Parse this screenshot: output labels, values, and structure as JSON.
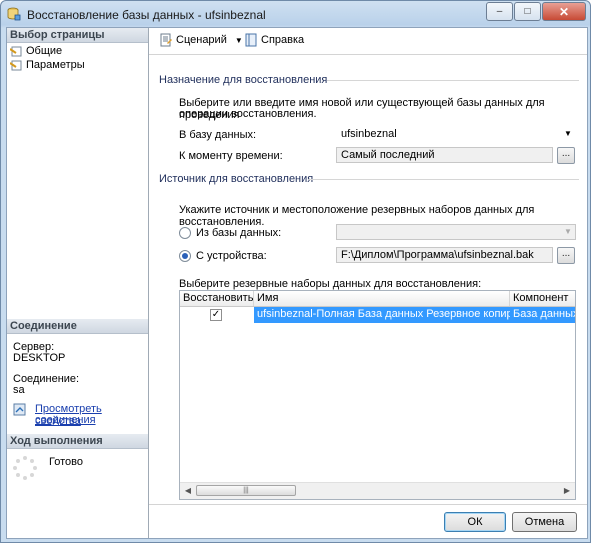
{
  "window": {
    "title": "Восстановление базы данных - ufsinbeznal",
    "minimize_glyph": "–",
    "maximize_glyph": "□",
    "close_glyph": "✕"
  },
  "left": {
    "pages_header": "Выбор страницы",
    "pages": [
      {
        "label": "Общие",
        "icon": "page-icon"
      },
      {
        "label": "Параметры",
        "icon": "page-icon"
      }
    ],
    "connection_header": "Соединение",
    "server_label": "Сервер:",
    "server_value": "DESKTOP",
    "connection_label": "Соединение:",
    "connection_value": "sa",
    "view_props_link_line1": "Просмотреть свойства",
    "view_props_link_line2": "соединения",
    "progress_header": "Ход выполнения",
    "progress_status": "Готово"
  },
  "toolbar": {
    "script_label": "Сценарий",
    "help_label": "Справка"
  },
  "destination": {
    "group_label": "Назначение для восстановления",
    "hint_line1": "Выберите или введите имя новой или существующей базы данных для проведения",
    "hint_line2": "операции восстановления.",
    "to_db_label": "В базу данных:",
    "to_db_value": "ufsinbeznal",
    "point_in_time_label": "К моменту времени:",
    "point_in_time_value": "Самый последний"
  },
  "source": {
    "group_label": "Источник для восстановления",
    "hint": "Укажите источник и местоположение резервных наборов данных для восстановления.",
    "from_db_label": "Из базы данных:",
    "from_db_value": "",
    "from_device_label": "С устройства:",
    "from_device_value": "F:\\Диплом\\Программа\\ufsinbeznal.bak",
    "selected_option": "device",
    "browse_glyph": "..."
  },
  "backup_sets": {
    "label": "Выберите резервные наборы данных для восстановления:",
    "columns": [
      "Восстановить",
      "Имя",
      "Компонент"
    ],
    "rows": [
      {
        "restore": true,
        "name": "ufsinbeznal-Полная База данных Резервное копирование",
        "component": "База данных"
      }
    ],
    "check_glyph": "✓",
    "thumb_grip": "|||"
  },
  "footer": {
    "ok_label": "ОК",
    "cancel_label": "Отмена"
  },
  "colors": {
    "selection": "#3399ff",
    "link": "#1a3fae",
    "title_bar": "#b9d1ea"
  }
}
